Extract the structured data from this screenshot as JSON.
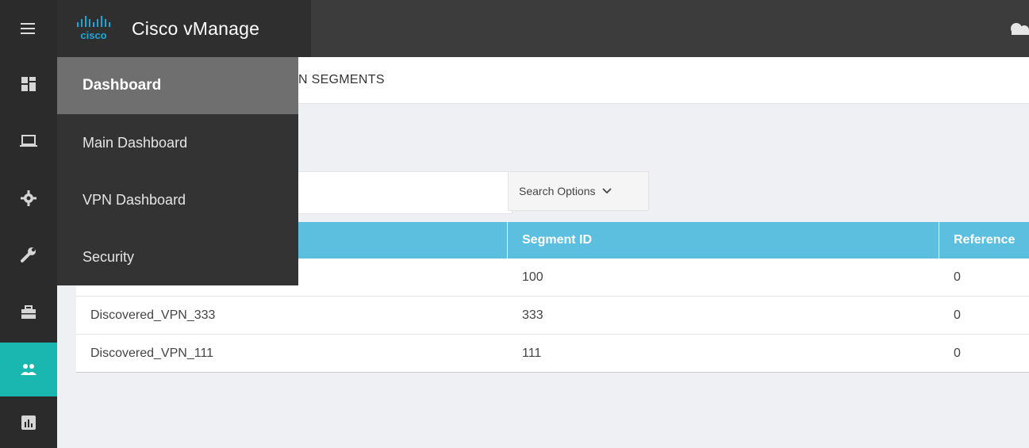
{
  "header": {
    "logo_text": "cisco",
    "app_title": "Cisco vManage"
  },
  "rail": {
    "items": [
      "hamburger-icon",
      "dashboard-icon",
      "monitor-icon",
      "gear-icon",
      "wrench-icon",
      "toolbox-icon",
      "users-icon",
      "report-icon"
    ],
    "active_index": 6
  },
  "subheader": {
    "title": "N SEGMENTS"
  },
  "search": {
    "placeholder": "",
    "options_label": "Search Options"
  },
  "table": {
    "columns": [
      "",
      "Segment ID",
      "Reference"
    ],
    "rows": [
      {
        "name": "",
        "segment_id": "100",
        "reference": "0"
      },
      {
        "name": "Discovered_VPN_333",
        "segment_id": "333",
        "reference": "0"
      },
      {
        "name": "Discovered_VPN_111",
        "segment_id": "111",
        "reference": "0"
      }
    ]
  },
  "dropdown": {
    "header": "Dashboard",
    "items": [
      "Main Dashboard",
      "VPN Dashboard",
      "Security"
    ]
  },
  "colors": {
    "rail_bg": "#2b2b2b",
    "active_teal": "#1ab7b1",
    "table_header": "#5cbfe0"
  }
}
